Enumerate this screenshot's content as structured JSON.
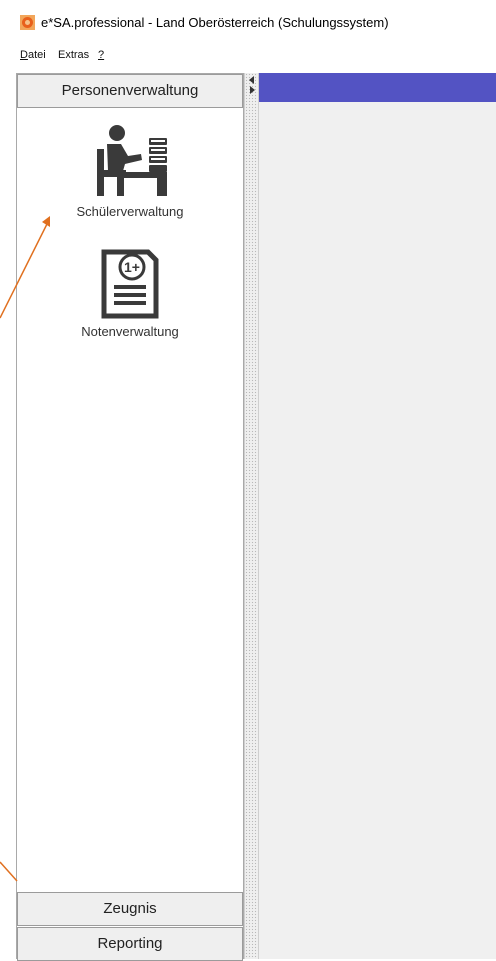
{
  "window": {
    "title": "e*SA.professional - Land Oberösterreich   (Schulungssystem)"
  },
  "menu": {
    "items": [
      {
        "mnemonic": "D",
        "rest": "atei"
      },
      {
        "mnemonic": "",
        "rest": "Extras"
      },
      {
        "mnemonic": "?",
        "rest": ""
      }
    ]
  },
  "sidebar": {
    "sections": {
      "personen": "Personenverwaltung",
      "zeugnis": "Zeugnis",
      "reporting": "Reporting"
    },
    "tiles": {
      "schueler": {
        "label": "Schülerverwaltung",
        "icon": "student-desk-icon"
      },
      "noten": {
        "label": "Notenverwaltung",
        "icon": "grade-document-icon"
      }
    }
  },
  "grade_icon_text": "1+",
  "colors": {
    "workspace_bar": "#5353c3",
    "annotation_arrow": "#e07020",
    "icon_dark": "#3a3a3a"
  }
}
